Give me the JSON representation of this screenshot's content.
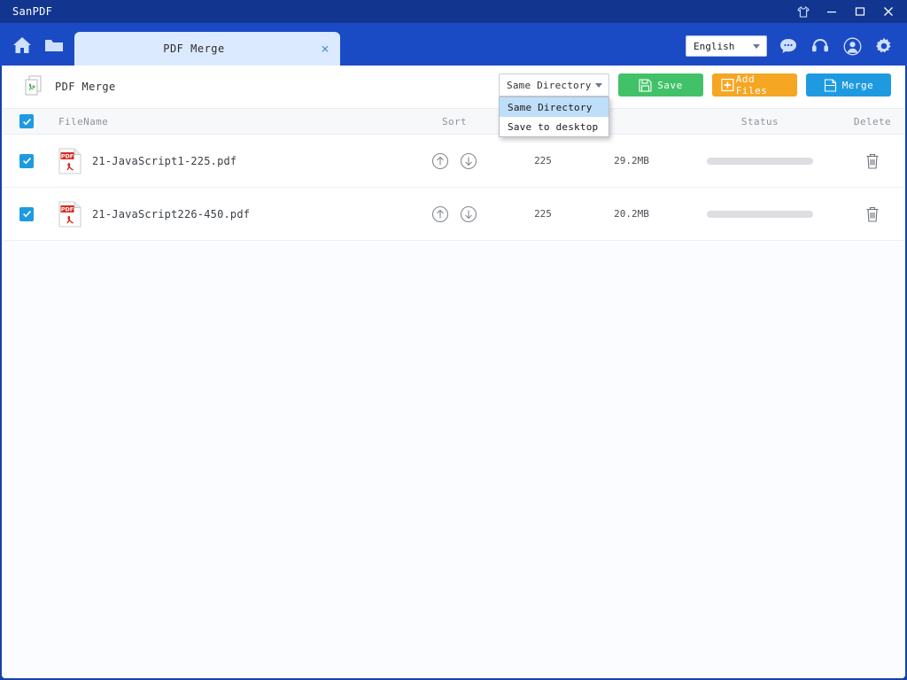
{
  "window": {
    "app_title": "SanPDF",
    "controls": [
      {
        "name": "skin-icon",
        "label": ""
      },
      {
        "name": "minimize-icon",
        "label": ""
      },
      {
        "name": "maximize-icon",
        "label": ""
      },
      {
        "name": "close-icon",
        "label": ""
      }
    ]
  },
  "toolbar": {
    "home_icon": "home-icon",
    "folder_icon": "folder-icon",
    "tab": {
      "label": "PDF Merge",
      "close": "×"
    },
    "language": {
      "value": "English",
      "options": [
        "English"
      ]
    },
    "right_icons": [
      "chat-icon",
      "headset-icon",
      "account-icon",
      "settings-icon"
    ]
  },
  "page": {
    "title": "PDF Merge",
    "icon": "pdf-merge-icon"
  },
  "actions": {
    "output_dir": {
      "value": "Same Directory",
      "open": true,
      "options": [
        {
          "label": "Same Directory",
          "selected": true
        },
        {
          "label": "Save to desktop",
          "selected": false
        }
      ]
    },
    "save_label": "Save",
    "add_files_label": "Add Files",
    "merge_label": "Merge"
  },
  "table": {
    "columns": {
      "filename": "FileName",
      "sort": "Sort",
      "page": "",
      "size": "",
      "status": "Status",
      "delete": "Delete"
    },
    "select_all_checked": true,
    "rows": [
      {
        "checked": true,
        "filename": "21-JavaScript1-225.pdf",
        "pages": "225",
        "size": "29.2MB",
        "status": "",
        "progress": 0
      },
      {
        "checked": true,
        "filename": "21-JavaScript226-450.pdf",
        "pages": "225",
        "size": "20.2MB",
        "status": "",
        "progress": 0
      }
    ]
  },
  "colors": {
    "titlebar": "#12368f",
    "toolbar": "#1b4bc4",
    "tab_active": "#dceaff",
    "accent_blue": "#1e9be0",
    "save_green": "#42c268",
    "add_orange": "#f5a623",
    "dropdown_highlight": "#bfdefa"
  }
}
